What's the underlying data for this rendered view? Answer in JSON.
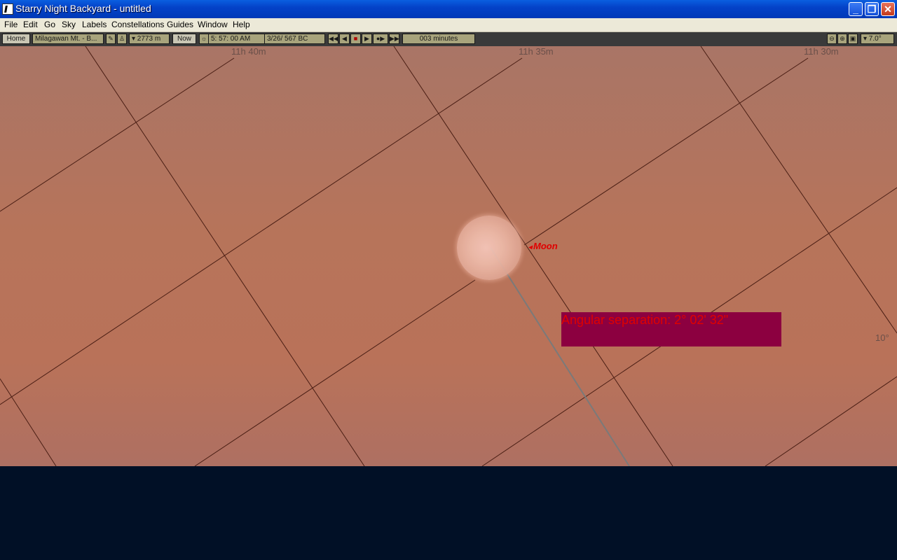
{
  "window": {
    "title": "Starry Night Backyard - untitled"
  },
  "menu": [
    "File",
    "Edit",
    "Go",
    "Sky",
    "Labels",
    "Constellations",
    "Guides",
    "Window",
    "Help"
  ],
  "toolbar": {
    "home": "Home",
    "location": "Milagawan Mt. - B...",
    "elevation": "▾ 2773 m",
    "now": "Now",
    "time": "5: 57: 00 AM",
    "date": "3/26/  567 BC",
    "step": "003 minutes",
    "fov": "▾ 7.0°"
  },
  "sky": {
    "ra_labels": [
      "11h 40m",
      "11h 35m",
      "11h 30m"
    ],
    "dec_label": "10°",
    "moon_label": "Moon",
    "separation": "Angular separation: 2° 02' 32\""
  },
  "colors": {
    "sky": "#b7745a",
    "ground": "#011026",
    "label_red": "#e00000",
    "sep_box": "#8c0040"
  }
}
